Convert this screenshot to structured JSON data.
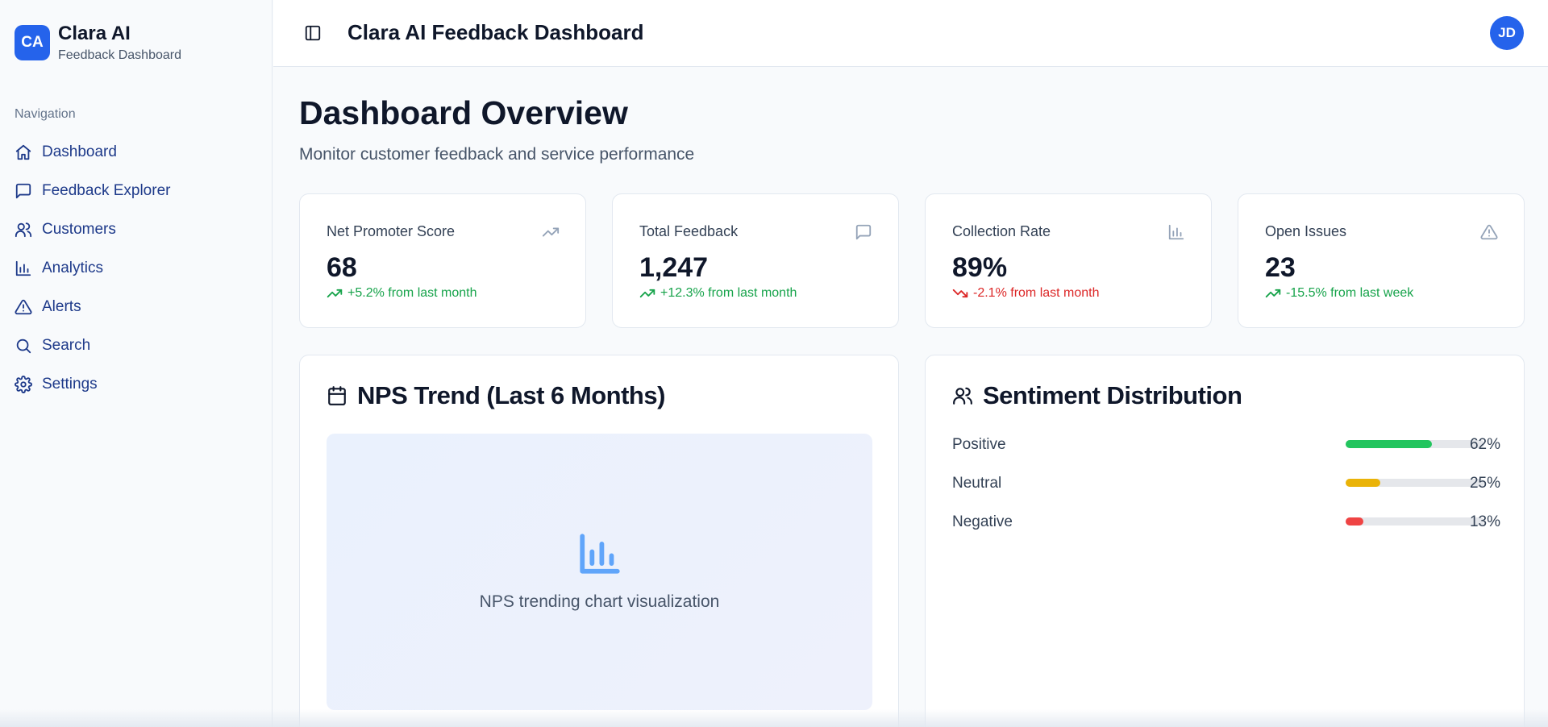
{
  "brand": {
    "logo": "CA",
    "title": "Clara AI",
    "subtitle": "Feedback Dashboard"
  },
  "sidebar": {
    "section_label": "Navigation",
    "items": [
      {
        "label": "Dashboard",
        "icon": "home-icon"
      },
      {
        "label": "Feedback Explorer",
        "icon": "message-square-icon"
      },
      {
        "label": "Customers",
        "icon": "users-icon"
      },
      {
        "label": "Analytics",
        "icon": "bar-chart-icon"
      },
      {
        "label": "Alerts",
        "icon": "alert-triangle-icon"
      },
      {
        "label": "Search",
        "icon": "search-icon"
      },
      {
        "label": "Settings",
        "icon": "gear-icon"
      }
    ]
  },
  "header": {
    "title": "Clara AI Feedback Dashboard",
    "avatar": "JD"
  },
  "page": {
    "title": "Dashboard Overview",
    "subtitle": "Monitor customer feedback and service performance"
  },
  "stats": [
    {
      "label": "Net Promoter Score",
      "value": "68",
      "delta": "+5.2% from last month",
      "trend": "up",
      "icon": "trending-up-icon"
    },
    {
      "label": "Total Feedback",
      "value": "1,247",
      "delta": "+12.3% from last month",
      "trend": "up",
      "icon": "message-square-icon"
    },
    {
      "label": "Collection Rate",
      "value": "89%",
      "delta": "-2.1% from last month",
      "trend": "down",
      "icon": "bar-chart-icon"
    },
    {
      "label": "Open Issues",
      "value": "23",
      "delta": "-15.5% from last week",
      "trend": "up",
      "icon": "alert-triangle-icon"
    }
  ],
  "nps_panel": {
    "title": "NPS Trend (Last 6 Months)",
    "icon": "calendar-icon",
    "placeholder": "NPS trending chart visualization",
    "placeholder_icon": "bar-chart-icon"
  },
  "sentiment_panel": {
    "title": "Sentiment Distribution",
    "icon": "users-icon",
    "rows": [
      {
        "label": "Positive",
        "percent": 62,
        "display": "62%",
        "color": "#22c55e"
      },
      {
        "label": "Neutral",
        "percent": 25,
        "display": "25%",
        "color": "#eab308"
      },
      {
        "label": "Negative",
        "percent": 13,
        "display": "13%",
        "color": "#ef4444"
      }
    ]
  },
  "colors": {
    "accent": "#2563eb",
    "positive": "#16a34a",
    "negative": "#dc2626"
  }
}
